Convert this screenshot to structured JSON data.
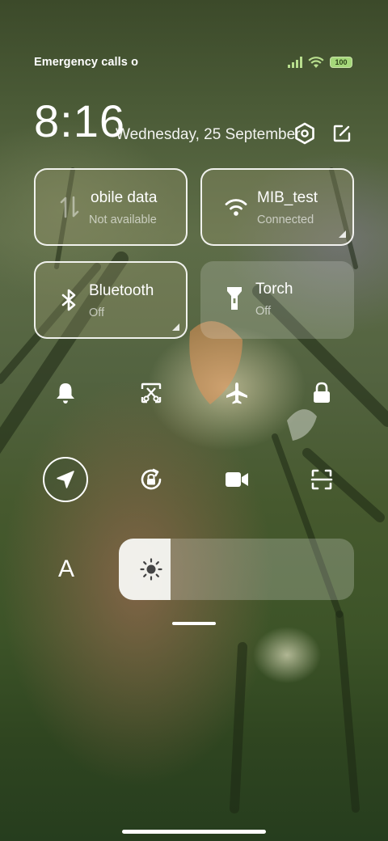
{
  "status_bar": {
    "carrier_text": "Emergency calls o",
    "battery_level": "100",
    "signal_icon": "signal-bars-icon",
    "wifi_icon": "wifi-icon",
    "battery_icon": "battery-icon"
  },
  "header": {
    "time": "8:16",
    "date": "Wednesday, 25 September",
    "settings_icon": "settings-hexagon-icon",
    "edit_icon": "edit-icon"
  },
  "tiles": {
    "mobile_data": {
      "title": "obile data",
      "subtitle": "Not available",
      "icon": "mobile-data-arrows-icon",
      "active": true
    },
    "wifi": {
      "title": "MIB_test",
      "subtitle": "Connected",
      "icon": "wifi-icon",
      "active": true
    },
    "bluetooth": {
      "title": "Bluetooth",
      "subtitle": "Off",
      "icon": "bluetooth-icon",
      "active": true
    },
    "torch": {
      "title": "Torch",
      "subtitle": "Off",
      "icon": "flashlight-icon",
      "active": false
    }
  },
  "toggles_row1": [
    {
      "name": "notifications",
      "icon": "bell-icon",
      "active": false
    },
    {
      "name": "screenshot",
      "icon": "scissors-screenshot-icon",
      "active": false
    },
    {
      "name": "airplane-mode",
      "icon": "airplane-icon",
      "active": false
    },
    {
      "name": "lock-screen",
      "icon": "lock-icon",
      "active": false
    }
  ],
  "toggles_row2": [
    {
      "name": "location",
      "icon": "location-arrow-icon",
      "active": true
    },
    {
      "name": "rotation-lock",
      "icon": "rotation-lock-icon",
      "active": false
    },
    {
      "name": "screen-recorder",
      "icon": "video-camera-icon",
      "active": false
    },
    {
      "name": "scanner",
      "icon": "scan-frame-icon",
      "active": false
    }
  ],
  "brightness": {
    "font_button_label": "A",
    "level": 0.22,
    "icon": "sun-icon"
  },
  "colors": {
    "accent_white": "#ffffff",
    "battery_green": "#a5d87a",
    "wallpaper_dark": "#263d1e"
  }
}
